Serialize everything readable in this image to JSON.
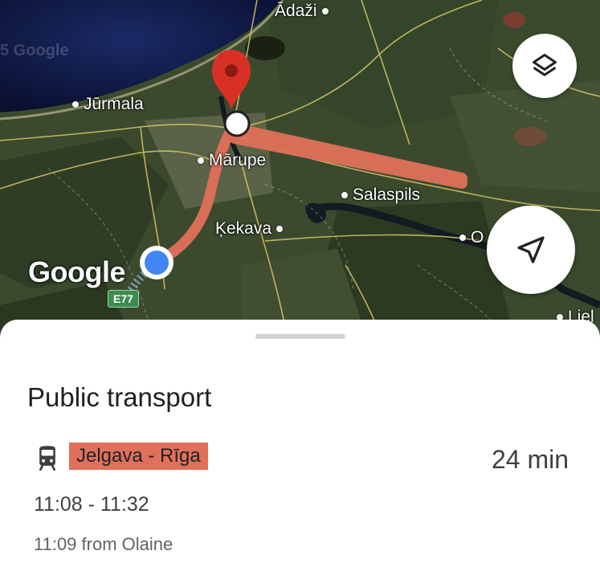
{
  "map": {
    "places": {
      "adazi": "Ādaži",
      "jurmala": "Jūrmala",
      "marupe": "Mārupe",
      "salaspils": "Salaspils",
      "kekava": "Ķekava",
      "edge_o": "O",
      "edge_liel": "Liel"
    },
    "watermark": "5 Google",
    "google_logo": "Google",
    "road_shield": "E77",
    "route_color": "#e0705a",
    "current_location_color": "#4285f4",
    "destination_pin_color": "#d93025"
  },
  "controls": {
    "layers_icon": "layers-icon",
    "location_icon": "navigation-arrow-icon"
  },
  "sheet": {
    "title": "Public transport",
    "transit_icon": "train-icon",
    "line_name": "Jelgava - Rīga",
    "line_color": "#e0705a",
    "duration": "24 min",
    "time_range": "11:08 - 11:32",
    "departure_info": "11:09 from Olaine"
  }
}
